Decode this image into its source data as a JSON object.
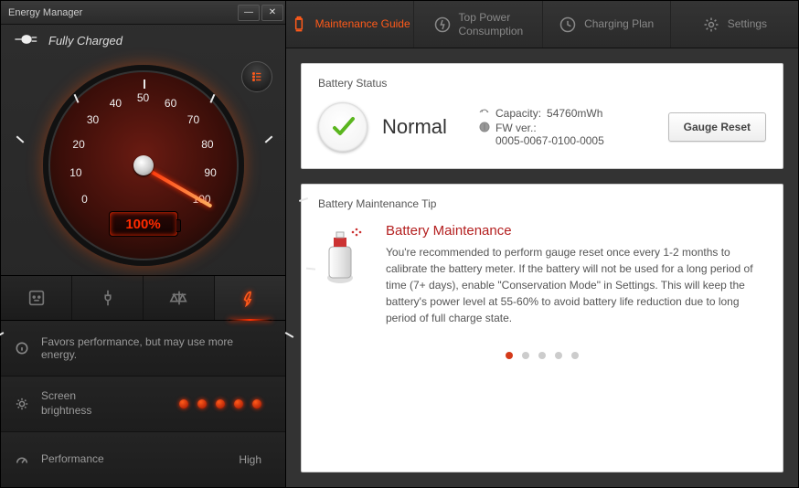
{
  "app_title": "Energy Manager",
  "charge_status": "Fully Charged",
  "gauge": {
    "percent_label": "100%",
    "ticks": [
      "0",
      "10",
      "20",
      "30",
      "40",
      "50",
      "60",
      "70",
      "80",
      "90",
      "100"
    ]
  },
  "mode_description": "Favors performance, but may use more energy.",
  "rows": {
    "brightness_label": "Screen brightness",
    "brightness_level": 5,
    "performance_label": "Performance",
    "performance_value": "High"
  },
  "nav": {
    "maintenance": "Maintenance Guide",
    "top_power": "Top Power Consumption",
    "charging_plan": "Charging Plan",
    "settings": "Settings"
  },
  "battery_status": {
    "heading": "Battery Status",
    "state": "Normal",
    "capacity_label": "Capacity:",
    "capacity_value": "54760mWh",
    "fw_label": "FW ver.:",
    "fw_value": "0005-0067-0100-0005",
    "reset_btn": "Gauge Reset"
  },
  "tip": {
    "heading": "Battery Maintenance Tip",
    "title": "Battery Maintenance",
    "body": "You're recommended to perform gauge reset once every 1-2 months to calibrate the battery meter. If the battery will not be used for a long period of time (7+ days), enable \"Conservation Mode\" in Settings. This will keep the battery's power level at 55-60% to avoid battery life reduction due to long period of full charge state.",
    "page_count": 5,
    "active_page": 1
  }
}
